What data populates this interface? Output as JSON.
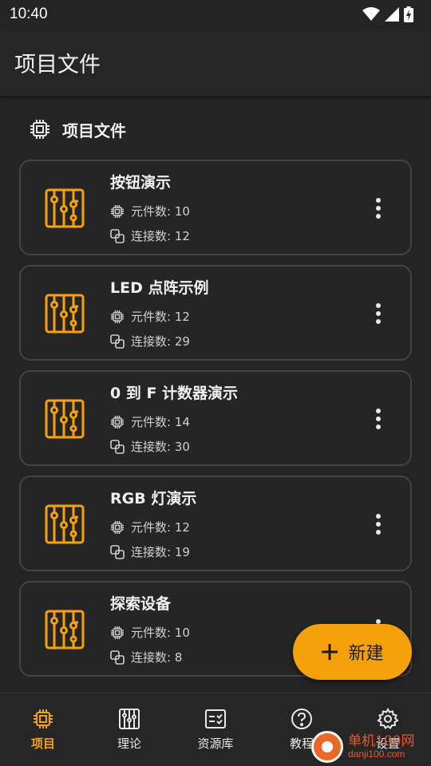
{
  "status_bar": {
    "time": "10:40",
    "icons": [
      "wifi-icon",
      "signal-icon",
      "battery-charging-icon"
    ]
  },
  "app_bar": {
    "title": "项目文件"
  },
  "section": {
    "icon": "chip-icon",
    "title": "项目文件"
  },
  "projects": [
    {
      "title": "按钮演示",
      "components_label": "元件数: 10",
      "connections_label": "连接数: 12"
    },
    {
      "title": "LED 点阵示例",
      "components_label": "元件数: 12",
      "connections_label": "连接数: 29"
    },
    {
      "title": "0 到 F 计数器演示",
      "components_label": "元件数: 14",
      "connections_label": "连接数: 30"
    },
    {
      "title": "RGB 灯演示",
      "components_label": "元件数: 12",
      "connections_label": "连接数: 19"
    },
    {
      "title": "探索设备",
      "components_label": "元件数: 10",
      "connections_label": "连接数: 8"
    }
  ],
  "fab": {
    "icon": "plus-icon",
    "label": "新建"
  },
  "bottom_nav": [
    {
      "label": "项目",
      "icon": "chip-icon",
      "active": true
    },
    {
      "label": "理论",
      "icon": "circuit-board-icon",
      "active": false
    },
    {
      "label": "资源库",
      "icon": "checklist-icon",
      "active": false
    },
    {
      "label": "教程",
      "icon": "help-circle-icon",
      "active": false
    },
    {
      "label": "设置",
      "icon": "gear-icon",
      "active": false
    }
  ],
  "watermark": {
    "line1": "单机100网",
    "line2": "danji100.com"
  },
  "colors": {
    "accent": "#f5a20a",
    "background": "#242424",
    "card_border": "#444444"
  }
}
